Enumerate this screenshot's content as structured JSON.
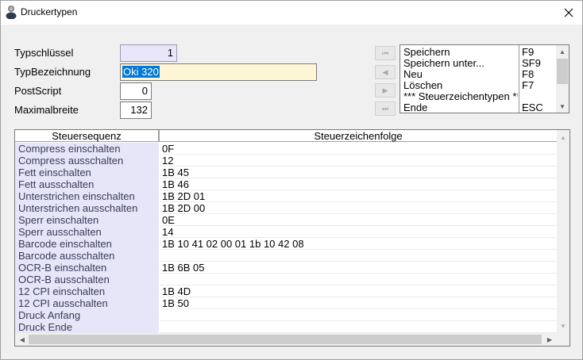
{
  "window": {
    "title": "Druckertypen"
  },
  "form": {
    "typschluessel": {
      "label": "Typschlüssel",
      "value": "1"
    },
    "typbezeichnung": {
      "label": "TypBezeichnung",
      "value": "Oki 320"
    },
    "postscript": {
      "label": "PostScript",
      "value": "0"
    },
    "maximalbreite": {
      "label": "Maximalbreite",
      "value": "132"
    }
  },
  "nav": {
    "first": "⏮",
    "prev": "◀",
    "next": "▶",
    "last": "⏭"
  },
  "menu": {
    "items": [
      {
        "label": "Speichern",
        "key": "F9"
      },
      {
        "label": "Speichern unter...",
        "key": "SF9"
      },
      {
        "label": "Neu",
        "key": "F8"
      },
      {
        "label": "Löschen",
        "key": "F7"
      },
      {
        "label": "*** Steuerzeichentypen ***",
        "key": ""
      },
      {
        "label": "Ende",
        "key": "ESC"
      }
    ],
    "scroll_up": "▲",
    "scroll_down": "▼"
  },
  "grid": {
    "headers": {
      "col1": "Steuersequenz",
      "col2": "Steuerzeichenfolge"
    },
    "rows": [
      {
        "seq": "Compress einschalten",
        "code": "0F"
      },
      {
        "seq": "Compress ausschalten",
        "code": "12"
      },
      {
        "seq": "Fett einschalten",
        "code": "1B 45"
      },
      {
        "seq": "Fett ausschalten",
        "code": "1B 46"
      },
      {
        "seq": "Unterstrichen einschalten",
        "code": "1B 2D 01"
      },
      {
        "seq": "Unterstrichen ausschalten",
        "code": "1B 2D 00"
      },
      {
        "seq": "Sperr einschalten",
        "code": "0E"
      },
      {
        "seq": "Sperr ausschalten",
        "code": "14"
      },
      {
        "seq": "Barcode einschalten",
        "code": "1B 10 41 02 00 01 1b 10 42 08"
      },
      {
        "seq": "Barcode ausschalten",
        "code": ""
      },
      {
        "seq": "OCR-B einschalten",
        "code": "1B 6B 05"
      },
      {
        "seq": "OCR-B ausschalten",
        "code": ""
      },
      {
        "seq": "12 CPI einschalten",
        "code": "1B 4D"
      },
      {
        "seq": "12 CPI ausschalten",
        "code": "1B 50"
      },
      {
        "seq": "Druck Anfang",
        "code": ""
      },
      {
        "seq": "Druck Ende",
        "code": ""
      }
    ],
    "scroll_up": "▲",
    "scroll_down": "▼",
    "scroll_left": "◀",
    "scroll_right": "▶"
  },
  "colors": {
    "selection": "#0078d7",
    "row_label_bg": "#e6e6f8",
    "input_yellow": "#fdf5d6"
  },
  "icons": {
    "app": "user-icon",
    "close": "close-icon"
  }
}
